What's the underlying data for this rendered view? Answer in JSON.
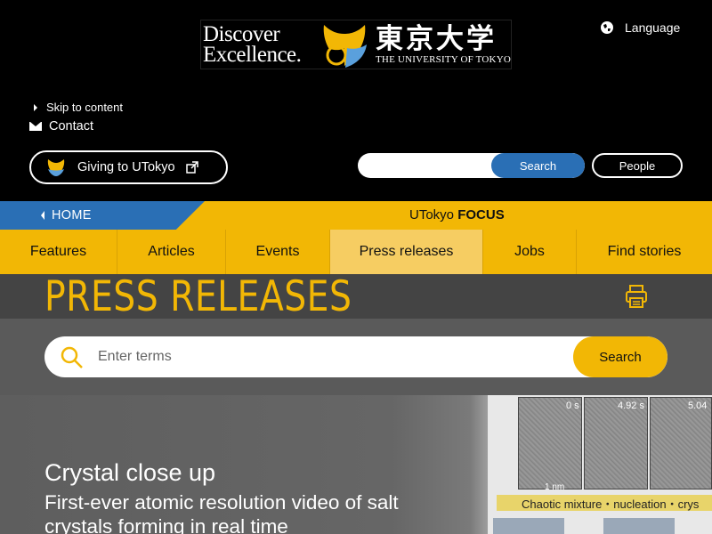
{
  "header": {
    "logo_tagline": "Discover Excellence.",
    "logo_jp": "東京大学",
    "logo_en": "THE UNIVERSITY OF TOKYO",
    "language_label": "Language"
  },
  "utility": {
    "skip_label": "Skip to content",
    "contact_label": "Contact",
    "giving_label": "Giving to UTokyo",
    "search_button": "Search",
    "people_button": "People"
  },
  "focus_bar": {
    "home_label": "HOME",
    "title_prefix": "UTokyo",
    "title_bold": "FOCUS"
  },
  "nav": {
    "items": [
      {
        "label": "Features"
      },
      {
        "label": "Articles"
      },
      {
        "label": "Events"
      },
      {
        "label": "Press releases"
      },
      {
        "label": "Jobs"
      },
      {
        "label": "Find stories"
      }
    ],
    "active": "Press releases"
  },
  "page": {
    "title": "PRESS RELEASES",
    "search_placeholder": "Enter terms",
    "search_button": "Search"
  },
  "hero": {
    "kicker": "Crystal close up",
    "headline": "First-ever atomic resolution video of salt crystals forming in real time",
    "image_labels": [
      "0 s",
      "4.92 s",
      "5.04"
    ],
    "scale_label": "1 nm",
    "caption": "Chaotic mixture・nucleation・crys"
  },
  "colors": {
    "accent_yellow": "#f2b705",
    "accent_blue": "#2a6fb5",
    "background": "#000000"
  }
}
